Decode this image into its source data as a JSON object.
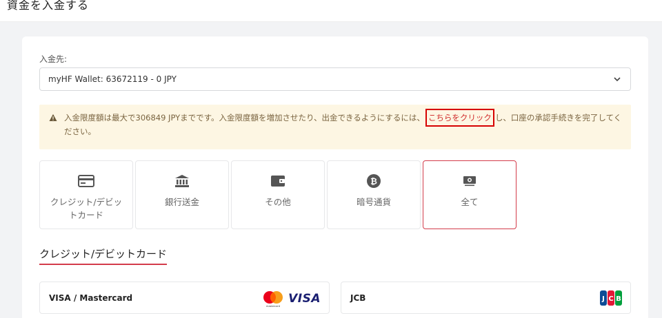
{
  "page": {
    "title": "資金を入金する"
  },
  "deposit_target": {
    "label": "入金先:",
    "selected": "myHF Wallet: 63672119 - 0 JPY"
  },
  "alert": {
    "text_before": "入金限度額は最大で306849 JPYまでです。入金限度額を増加させたり、出金できるようにするには、",
    "link": "こちらをクリック",
    "text_after": "し、口座の承認手続きを完了してください。"
  },
  "methods": [
    {
      "label": "クレジット/デビットカード",
      "icon": "credit-card-icon"
    },
    {
      "label": "銀行送金",
      "icon": "bank-icon"
    },
    {
      "label": "その他",
      "icon": "wallet-icon"
    },
    {
      "label": "暗号通貨",
      "icon": "bitcoin-icon"
    },
    {
      "label": "全て",
      "icon": "money-icon",
      "active": true
    }
  ],
  "section": {
    "title": "クレジット/デビットカード"
  },
  "payment_options": [
    {
      "name": "VISA / Mastercard",
      "logo_text": "VISA",
      "logo_small": "mastercard"
    },
    {
      "name": "JCB",
      "logo_text": "JCB"
    }
  ],
  "colors": {
    "accent": "#d33b4a",
    "alert_bg": "#fdf6e3",
    "link": "#d12d2d"
  }
}
